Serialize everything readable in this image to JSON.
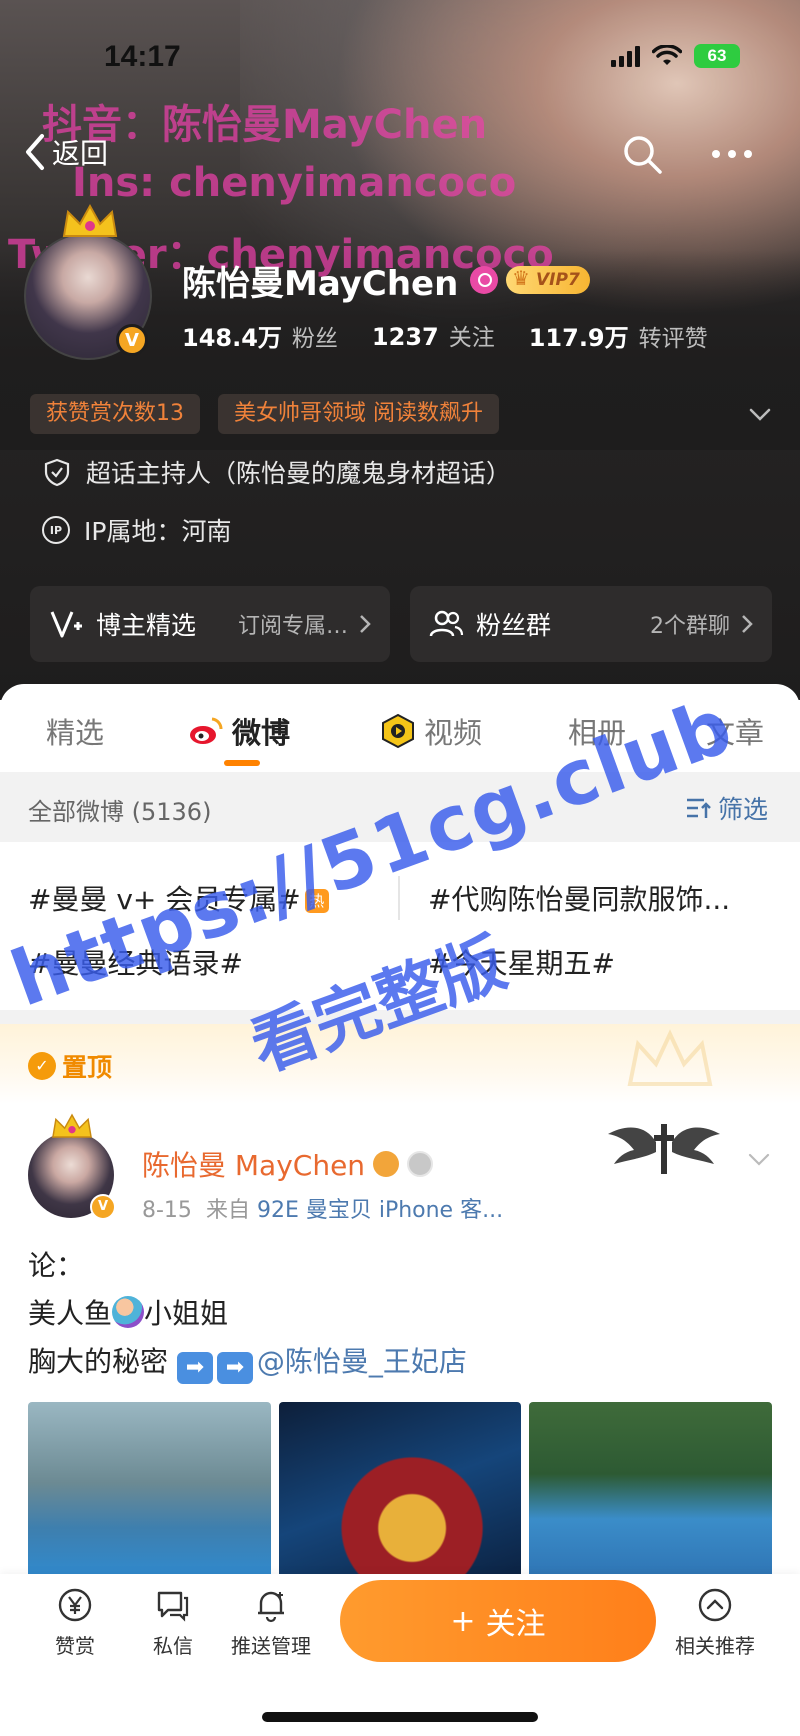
{
  "status_bar": {
    "time": "14:17",
    "battery": "63"
  },
  "nav": {
    "back_label": "返回"
  },
  "header_watermark": {
    "line1": "抖音：陈怡曼MayChen",
    "line2": "Ins: chenyimancoco",
    "line3": "Twitter：chenyimancoco"
  },
  "profile": {
    "name": "陈怡曼MayChen",
    "vip_label": "VIP7",
    "stats": [
      {
        "value": "148.4万",
        "label": "粉丝"
      },
      {
        "value": "1237",
        "label": "关注"
      },
      {
        "value": "117.9万",
        "label": "转评赞"
      }
    ],
    "tags": [
      "获赞赏次数13",
      "美女帅哥领域 阅读数飙升"
    ],
    "super_topic": "超话主持人（陈怡曼的魔鬼身材超话）",
    "ip_badge": "IP",
    "ip_location": "IP属地：河南",
    "card_left": {
      "title": "博主精选",
      "sub": "订阅专属…"
    },
    "card_right": {
      "title": "粉丝群",
      "sub": "2个群聊"
    }
  },
  "tabs": {
    "featured": "精选",
    "weibo": "微博",
    "video": "视频",
    "album": "相册",
    "articles": "文章"
  },
  "filter": {
    "label": "全部微博 (5136)",
    "button": "筛选"
  },
  "topics": {
    "t1": "#曼曼 v+ 会员专属#",
    "t1_badge": "热",
    "t2": "#代购陈怡曼同款服饰...",
    "t3": "#曼曼经典语录#",
    "t4": "#今天星期五#"
  },
  "pinned_label": "置顶",
  "post": {
    "author": "陈怡曼 MayChen",
    "v_badge": "V",
    "date": "8-15",
    "source_prefix": "来自",
    "source": "92E 曼宝贝 iPhone 客...",
    "line1": "论：",
    "line2_a": "美人鱼",
    "line2_b": "小姐姐",
    "line3_a": "胸大的秘密",
    "line3_mention": "@陈怡曼_王妃店"
  },
  "overlay_watermark": {
    "url": "https://51cg.club",
    "text": "看完整版"
  },
  "bottom_bar": {
    "reward": "赞赏",
    "message": "私信",
    "push": "推送管理",
    "follow": "关注",
    "follow_plus": "+",
    "recommend": "相关推荐"
  },
  "colors": {
    "accent_orange": "#ff8200",
    "link_blue": "#4d7aaf",
    "watermark_blue": "#385ceb",
    "watermark_pink": "#ec40aa"
  }
}
